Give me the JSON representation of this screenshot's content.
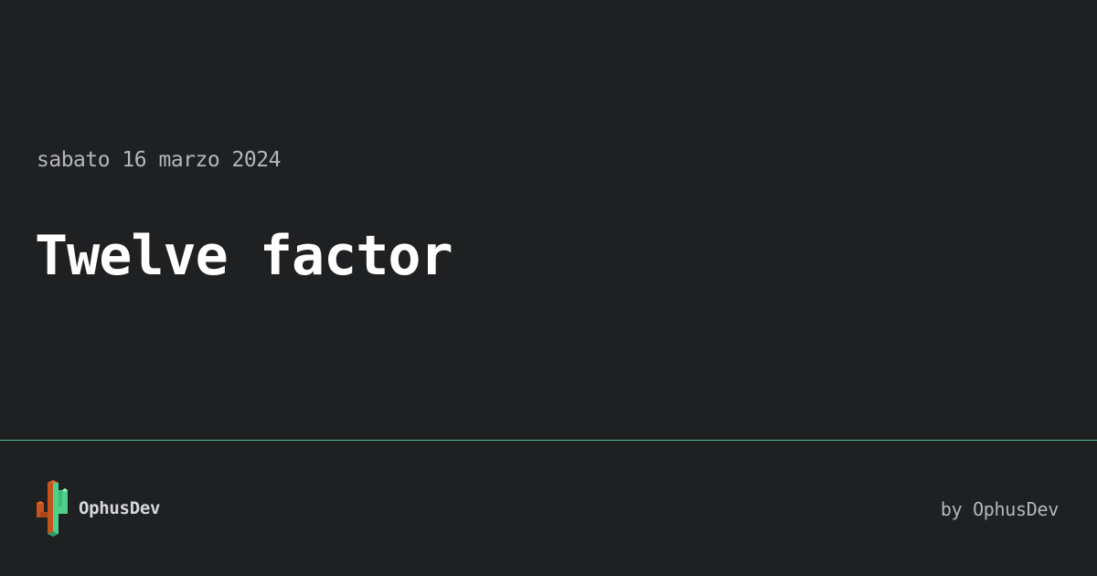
{
  "post": {
    "date": "sabato 16 marzo 2024",
    "title": "Twelve factor"
  },
  "footer": {
    "logo_icon": "cactus-pixel-logo-icon",
    "brand": "OphusDev",
    "byline": "by OphusDev"
  },
  "colors": {
    "background": "#1f2022",
    "divider": "#4fbf8f",
    "logo_green": "#4fd08a",
    "logo_orange": "#c4531c"
  }
}
